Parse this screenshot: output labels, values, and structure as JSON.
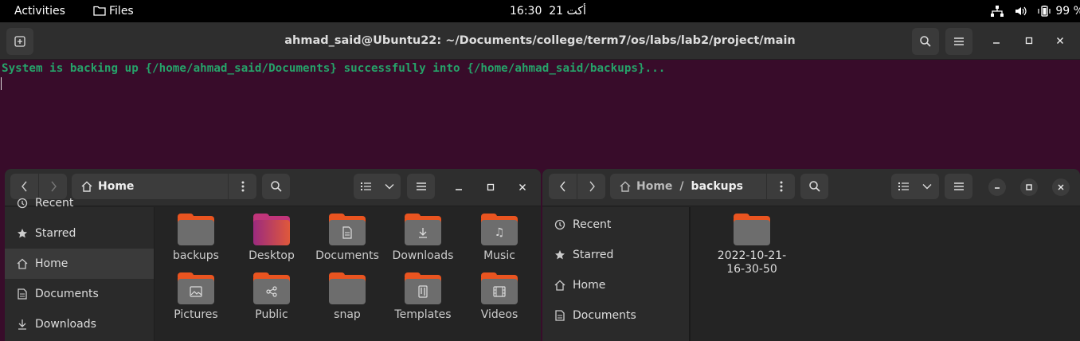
{
  "topbar": {
    "activities": "Activities",
    "app_name": "Files",
    "clock_time": "16:30",
    "clock_date": "أكت 21",
    "battery": "99 %"
  },
  "terminal": {
    "title": "ahmad_said@Ubuntu22: ~/Documents/college/term7/os/labs/lab2/project/main",
    "output_line": "System is backing up {/home/ahmad_said/Documents} successfully into {/home/ahmad_said/backups}...",
    "text_color": "#26a269",
    "bg_color": "#380c2a"
  },
  "files_left": {
    "path": [
      "Home"
    ],
    "sidebar": [
      {
        "label": "Recent",
        "icon": "clock-icon"
      },
      {
        "label": "Starred",
        "icon": "star-icon"
      },
      {
        "label": "Home",
        "icon": "home-icon",
        "selected": true
      },
      {
        "label": "Documents",
        "icon": "document-icon"
      },
      {
        "label": "Downloads",
        "icon": "download-icon"
      }
    ],
    "items": [
      {
        "label": "backups",
        "icon": "folder-icon"
      },
      {
        "label": "Desktop",
        "icon": "desktop-folder-icon"
      },
      {
        "label": "Documents",
        "icon": "documents-folder-icon"
      },
      {
        "label": "Downloads",
        "icon": "downloads-folder-icon"
      },
      {
        "label": "Music",
        "icon": "music-folder-icon"
      },
      {
        "label": "Pictures",
        "icon": "pictures-folder-icon"
      },
      {
        "label": "Public",
        "icon": "public-folder-icon"
      },
      {
        "label": "snap",
        "icon": "folder-icon"
      },
      {
        "label": "Templates",
        "icon": "templates-folder-icon"
      },
      {
        "label": "Videos",
        "icon": "videos-folder-icon"
      }
    ]
  },
  "files_right": {
    "path": [
      "Home",
      "/",
      "backups"
    ],
    "sidebar": [
      {
        "label": "Recent",
        "icon": "clock-icon"
      },
      {
        "label": "Starred",
        "icon": "star-icon"
      },
      {
        "label": "Home",
        "icon": "home-icon"
      },
      {
        "label": "Documents",
        "icon": "document-icon"
      }
    ],
    "items": [
      {
        "label_line1": "2022-10-21-",
        "label_line2": "16-30-50",
        "icon": "folder-icon"
      }
    ]
  },
  "colors": {
    "accent": "#e95420",
    "folder": "#6d6d6d",
    "header": "#2e2e2e"
  }
}
